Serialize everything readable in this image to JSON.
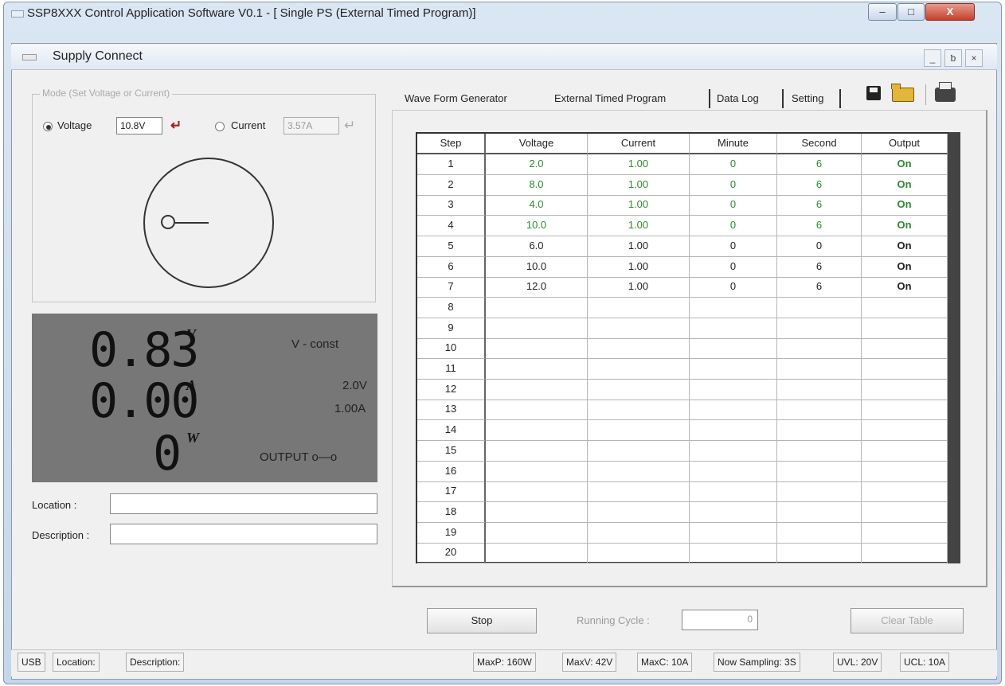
{
  "app": {
    "title": "SSP8XXX Control Application Software V0.1 - [ Single PS (External Timed Program)]"
  },
  "window_controls": {
    "minimize": "–",
    "maximize": "□",
    "close": "X"
  },
  "mdi": {
    "title": "Supply Connect",
    "controls": {
      "minimize": "_",
      "restore": "ƅ",
      "close": "×"
    }
  },
  "mode": {
    "legend": "Mode (Set Voltage or Current)",
    "voltage_label": "Voltage",
    "voltage_value": "10.8V",
    "current_label": "Current",
    "current_value": "3.57A",
    "enter_arrow": "↵",
    "selected": "Voltage"
  },
  "display": {
    "voltage_digits": "0.83",
    "voltage_unit": "V",
    "current_digits": "0.00",
    "current_unit": "A",
    "power_digits": "0",
    "power_unit": "W",
    "mode_status": "V - const",
    "set_voltage": "2.0V",
    "set_current": "1.00A",
    "output_status": "OUTPUT o—o"
  },
  "fields": {
    "location_label": "Location :",
    "description_label": "Description :",
    "location_value": "",
    "description_value": ""
  },
  "tabs": [
    "Wave Form Generator",
    "External Timed Program",
    "Data Log",
    "Setting"
  ],
  "toolbar_icons": [
    "save-icon",
    "open-folder-icon",
    "print-icon"
  ],
  "table": {
    "headers": [
      "Step",
      "Voltage",
      "Current",
      "Minute",
      "Second",
      "Output"
    ],
    "rows": [
      {
        "step": "1",
        "voltage": "2.0",
        "current": "1.00",
        "minute": "0",
        "second": "6",
        "output": "On",
        "state": "green"
      },
      {
        "step": "2",
        "voltage": "8.0",
        "current": "1.00",
        "minute": "0",
        "second": "6",
        "output": "On",
        "state": "green"
      },
      {
        "step": "3",
        "voltage": "4.0",
        "current": "1.00",
        "minute": "0",
        "second": "6",
        "output": "On",
        "state": "green"
      },
      {
        "step": "4",
        "voltage": "10.0",
        "current": "1.00",
        "minute": "0",
        "second": "6",
        "output": "On",
        "state": "green"
      },
      {
        "step": "5",
        "voltage": "6.0",
        "current": "1.00",
        "minute": "0",
        "second": "0",
        "output": "On",
        "state": "normal"
      },
      {
        "step": "6",
        "voltage": "10.0",
        "current": "1.00",
        "minute": "0",
        "second": "6",
        "output": "On",
        "state": "normal"
      },
      {
        "step": "7",
        "voltage": "12.0",
        "current": "1.00",
        "minute": "0",
        "second": "6",
        "output": "On",
        "state": "normal"
      },
      {
        "step": "8",
        "voltage": "",
        "current": "",
        "minute": "",
        "second": "",
        "output": ""
      },
      {
        "step": "9",
        "voltage": "",
        "current": "",
        "minute": "",
        "second": "",
        "output": ""
      },
      {
        "step": "10",
        "voltage": "",
        "current": "",
        "minute": "",
        "second": "",
        "output": ""
      },
      {
        "step": "11",
        "voltage": "",
        "current": "",
        "minute": "",
        "second": "",
        "output": ""
      },
      {
        "step": "12",
        "voltage": "",
        "current": "",
        "minute": "",
        "second": "",
        "output": ""
      },
      {
        "step": "13",
        "voltage": "",
        "current": "",
        "minute": "",
        "second": "",
        "output": ""
      },
      {
        "step": "14",
        "voltage": "",
        "current": "",
        "minute": "",
        "second": "",
        "output": ""
      },
      {
        "step": "15",
        "voltage": "",
        "current": "",
        "minute": "",
        "second": "",
        "output": ""
      },
      {
        "step": "16",
        "voltage": "",
        "current": "",
        "minute": "",
        "second": "",
        "output": ""
      },
      {
        "step": "17",
        "voltage": "",
        "current": "",
        "minute": "",
        "second": "",
        "output": ""
      },
      {
        "step": "18",
        "voltage": "",
        "current": "",
        "minute": "",
        "second": "",
        "output": ""
      },
      {
        "step": "19",
        "voltage": "",
        "current": "",
        "minute": "",
        "second": "",
        "output": ""
      },
      {
        "step": "20",
        "voltage": "",
        "current": "",
        "minute": "",
        "second": "",
        "output": ""
      }
    ]
  },
  "controls": {
    "stop_label": "Stop",
    "running_cycle_label": "Running Cycle :",
    "running_cycle_value": "0",
    "clear_table_label": "Clear Table"
  },
  "statusbar": {
    "left": [
      "USB",
      "Location:",
      "Description:"
    ],
    "right": [
      "MaxP: 160W",
      "MaxV: 42V",
      "MaxC: 10A",
      "Now Sampling: 3S",
      "UVL: 20V",
      "UCL: 10A"
    ]
  },
  "colors": {
    "active_row_text": "#2d8a2d",
    "display_bg": "#777777",
    "enter_arrow": "#b01818"
  }
}
